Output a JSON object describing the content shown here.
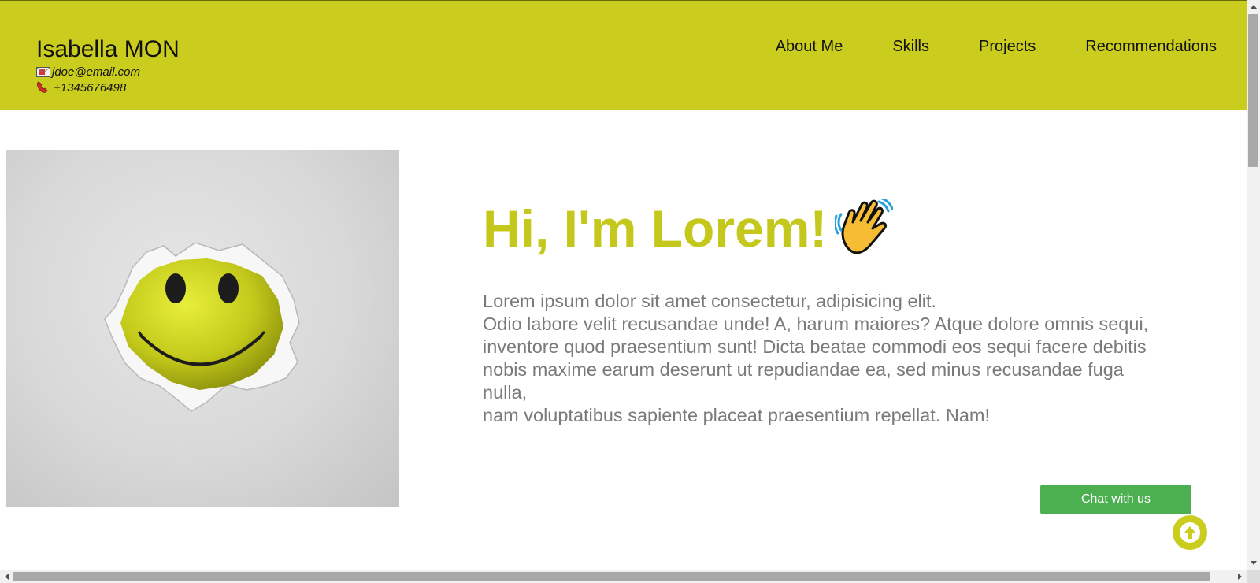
{
  "header": {
    "name": "Isabella MON",
    "email": "jdoe@email.com",
    "phone": "+1345676498",
    "bg_color": "#cacd1e",
    "email_icon": "envelope-icon",
    "phone_icon": "phone-icon"
  },
  "nav": {
    "items": [
      "About Me",
      "Skills",
      "Projects",
      "Recommendations"
    ]
  },
  "hero": {
    "image": "smiley-face-through-paper",
    "title": "Hi, I'm Lorem!",
    "title_icon": "waving-hand-icon",
    "title_color": "#c5c81c",
    "paragraphs": [
      "Lorem ipsum dolor sit amet consectetur, adipisicing elit.",
      "Odio labore velit recusandae unde! A, harum maiores? Atque dolore omnis sequi, inventore quod praesentium sunt! Dicta beatae commodi eos sequi facere debitis nobis maxime earum deserunt ut repudiandae ea, sed minus recusandae fuga nulla,",
      "nam voluptatibus sapiente placeat praesentium repellat. Nam!"
    ]
  },
  "chat_button": {
    "label": "Chat with us",
    "color": "#4caf50"
  },
  "scroll_top_button": {
    "icon": "arrow-up-icon"
  }
}
